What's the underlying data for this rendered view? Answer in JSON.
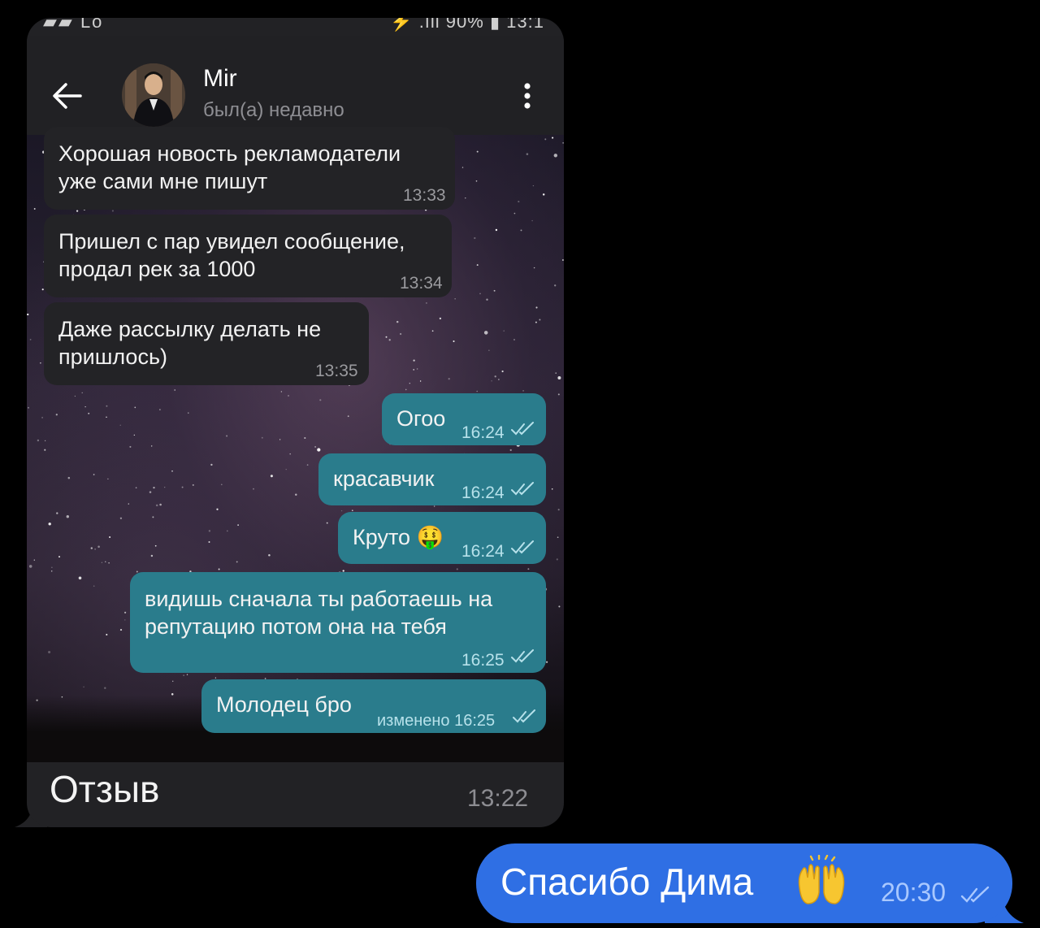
{
  "status_bar": {
    "left": "▰▰ Lo",
    "right": "⚡ .ıll 90% ▮ 13:1"
  },
  "header": {
    "name": "Mir",
    "status": "был(а) недавно"
  },
  "messages": [
    {
      "dir": "in",
      "text": "Хорошая новость рекламодатели\nуже сами мне пишут",
      "time": "13:33"
    },
    {
      "dir": "in",
      "text": "Пришел с пар увидел сообщение,\nпродал рек за 1000",
      "time": "13:34"
    },
    {
      "dir": "in",
      "text": "Даже рассылку делать не\nпришлось)",
      "time": "13:35"
    },
    {
      "dir": "out",
      "text": "Огоо",
      "time": "16:24"
    },
    {
      "dir": "out",
      "text": "красавчик",
      "time": "16:24"
    },
    {
      "dir": "out",
      "text": "Круто 🤑",
      "time": "16:24"
    },
    {
      "dir": "out",
      "text": "видишь сначала ты работаешь на\nрепутацию потом она на тебя",
      "time": "16:25"
    },
    {
      "dir": "out",
      "text": "Молодец бро",
      "time": "изменено 16:25"
    }
  ],
  "caption": {
    "text": "Отзыв",
    "time": "13:22"
  },
  "reply": {
    "text": "Спасибо Дима",
    "emoji_name": "raising-hands-icon",
    "time": "20:30"
  },
  "colors": {
    "incoming_bubble": "#232326",
    "outgoing_inner_bubble": "#2a7c8c",
    "sent_bubble": "#2f6fe4",
    "background": "#000000"
  }
}
